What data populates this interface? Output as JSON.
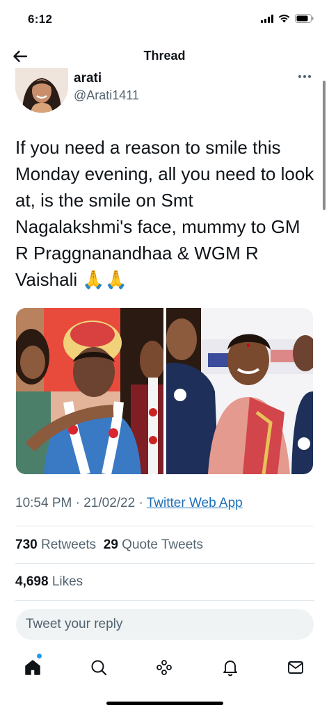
{
  "status_bar": {
    "time": "6:12"
  },
  "header": {
    "title": "Thread"
  },
  "author": {
    "name": "arati",
    "handle": "@Arati1411"
  },
  "tweet": {
    "text": "If you need a reason to smile this Monday evening, all you need to look at, is the smile on Smt Nagalakshmi's face, mummy to GM R Praggnanandhaa & WGM R Vaishali 🙏🙏",
    "time": "10:54 PM",
    "date": "21/02/22",
    "source": "Twitter Web App"
  },
  "stats": {
    "retweets_count": "730",
    "retweets_label": "Retweets",
    "quotes_count": "29",
    "quotes_label": "Quote Tweets",
    "likes_count": "4,698",
    "likes_label": "Likes"
  },
  "reply": {
    "placeholder": "Tweet your reply"
  },
  "icons": {
    "back": "arrow-left-icon",
    "more": "more-dots-icon",
    "home": "home-icon",
    "search": "search-icon",
    "spaces": "spaces-icon",
    "notifications": "bell-icon",
    "messages": "mail-icon"
  },
  "colors": {
    "link": "#1d6fb8",
    "notification_dot": "#1d9bf0",
    "muted": "#536471"
  }
}
